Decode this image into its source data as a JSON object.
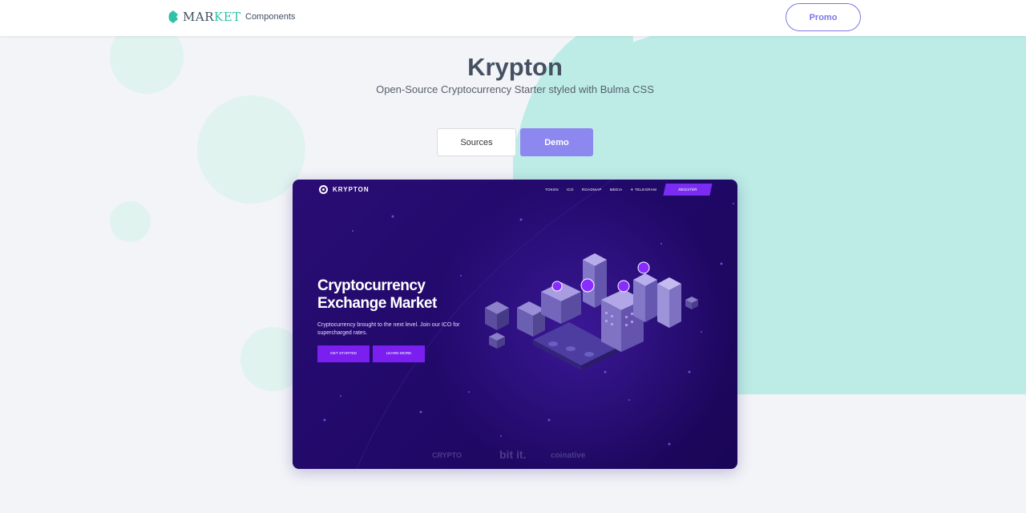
{
  "navbar": {
    "logo": {
      "part1": "MAR",
      "part2": "KET",
      "icon": "leaf-logo-icon"
    },
    "links": [
      "Components"
    ],
    "promo_label": "Promo"
  },
  "hero": {
    "title": "Krypton",
    "subtitle": "Open-Source Cryptocurrency Starter styled with Bulma CSS",
    "sources_label": "Sources",
    "demo_label": "Demo"
  },
  "preview": {
    "brand": "KRYPTON",
    "menu": [
      "TOKEN",
      "ICO",
      "ROADMAP",
      "MEDIA",
      "TELEGRAM"
    ],
    "register_label": "REGISTER",
    "headline_line1": "Cryptocurrency",
    "headline_line2": "Exchange Market",
    "description": "Cryptocurrency brought to the next level. Join our ICO for supercharged rates.",
    "get_started_label": "GET STARTED",
    "learn_more_label": "LEARN MORE",
    "partners": [
      "CRYPTO",
      "bit it.",
      "coinative"
    ]
  },
  "colors": {
    "accent": "#8c88f0",
    "brand_teal": "#2fc2a8",
    "mint_bg": "#bdece6",
    "preview_bg": "#21096a",
    "preview_button": "#7a1ff0"
  }
}
